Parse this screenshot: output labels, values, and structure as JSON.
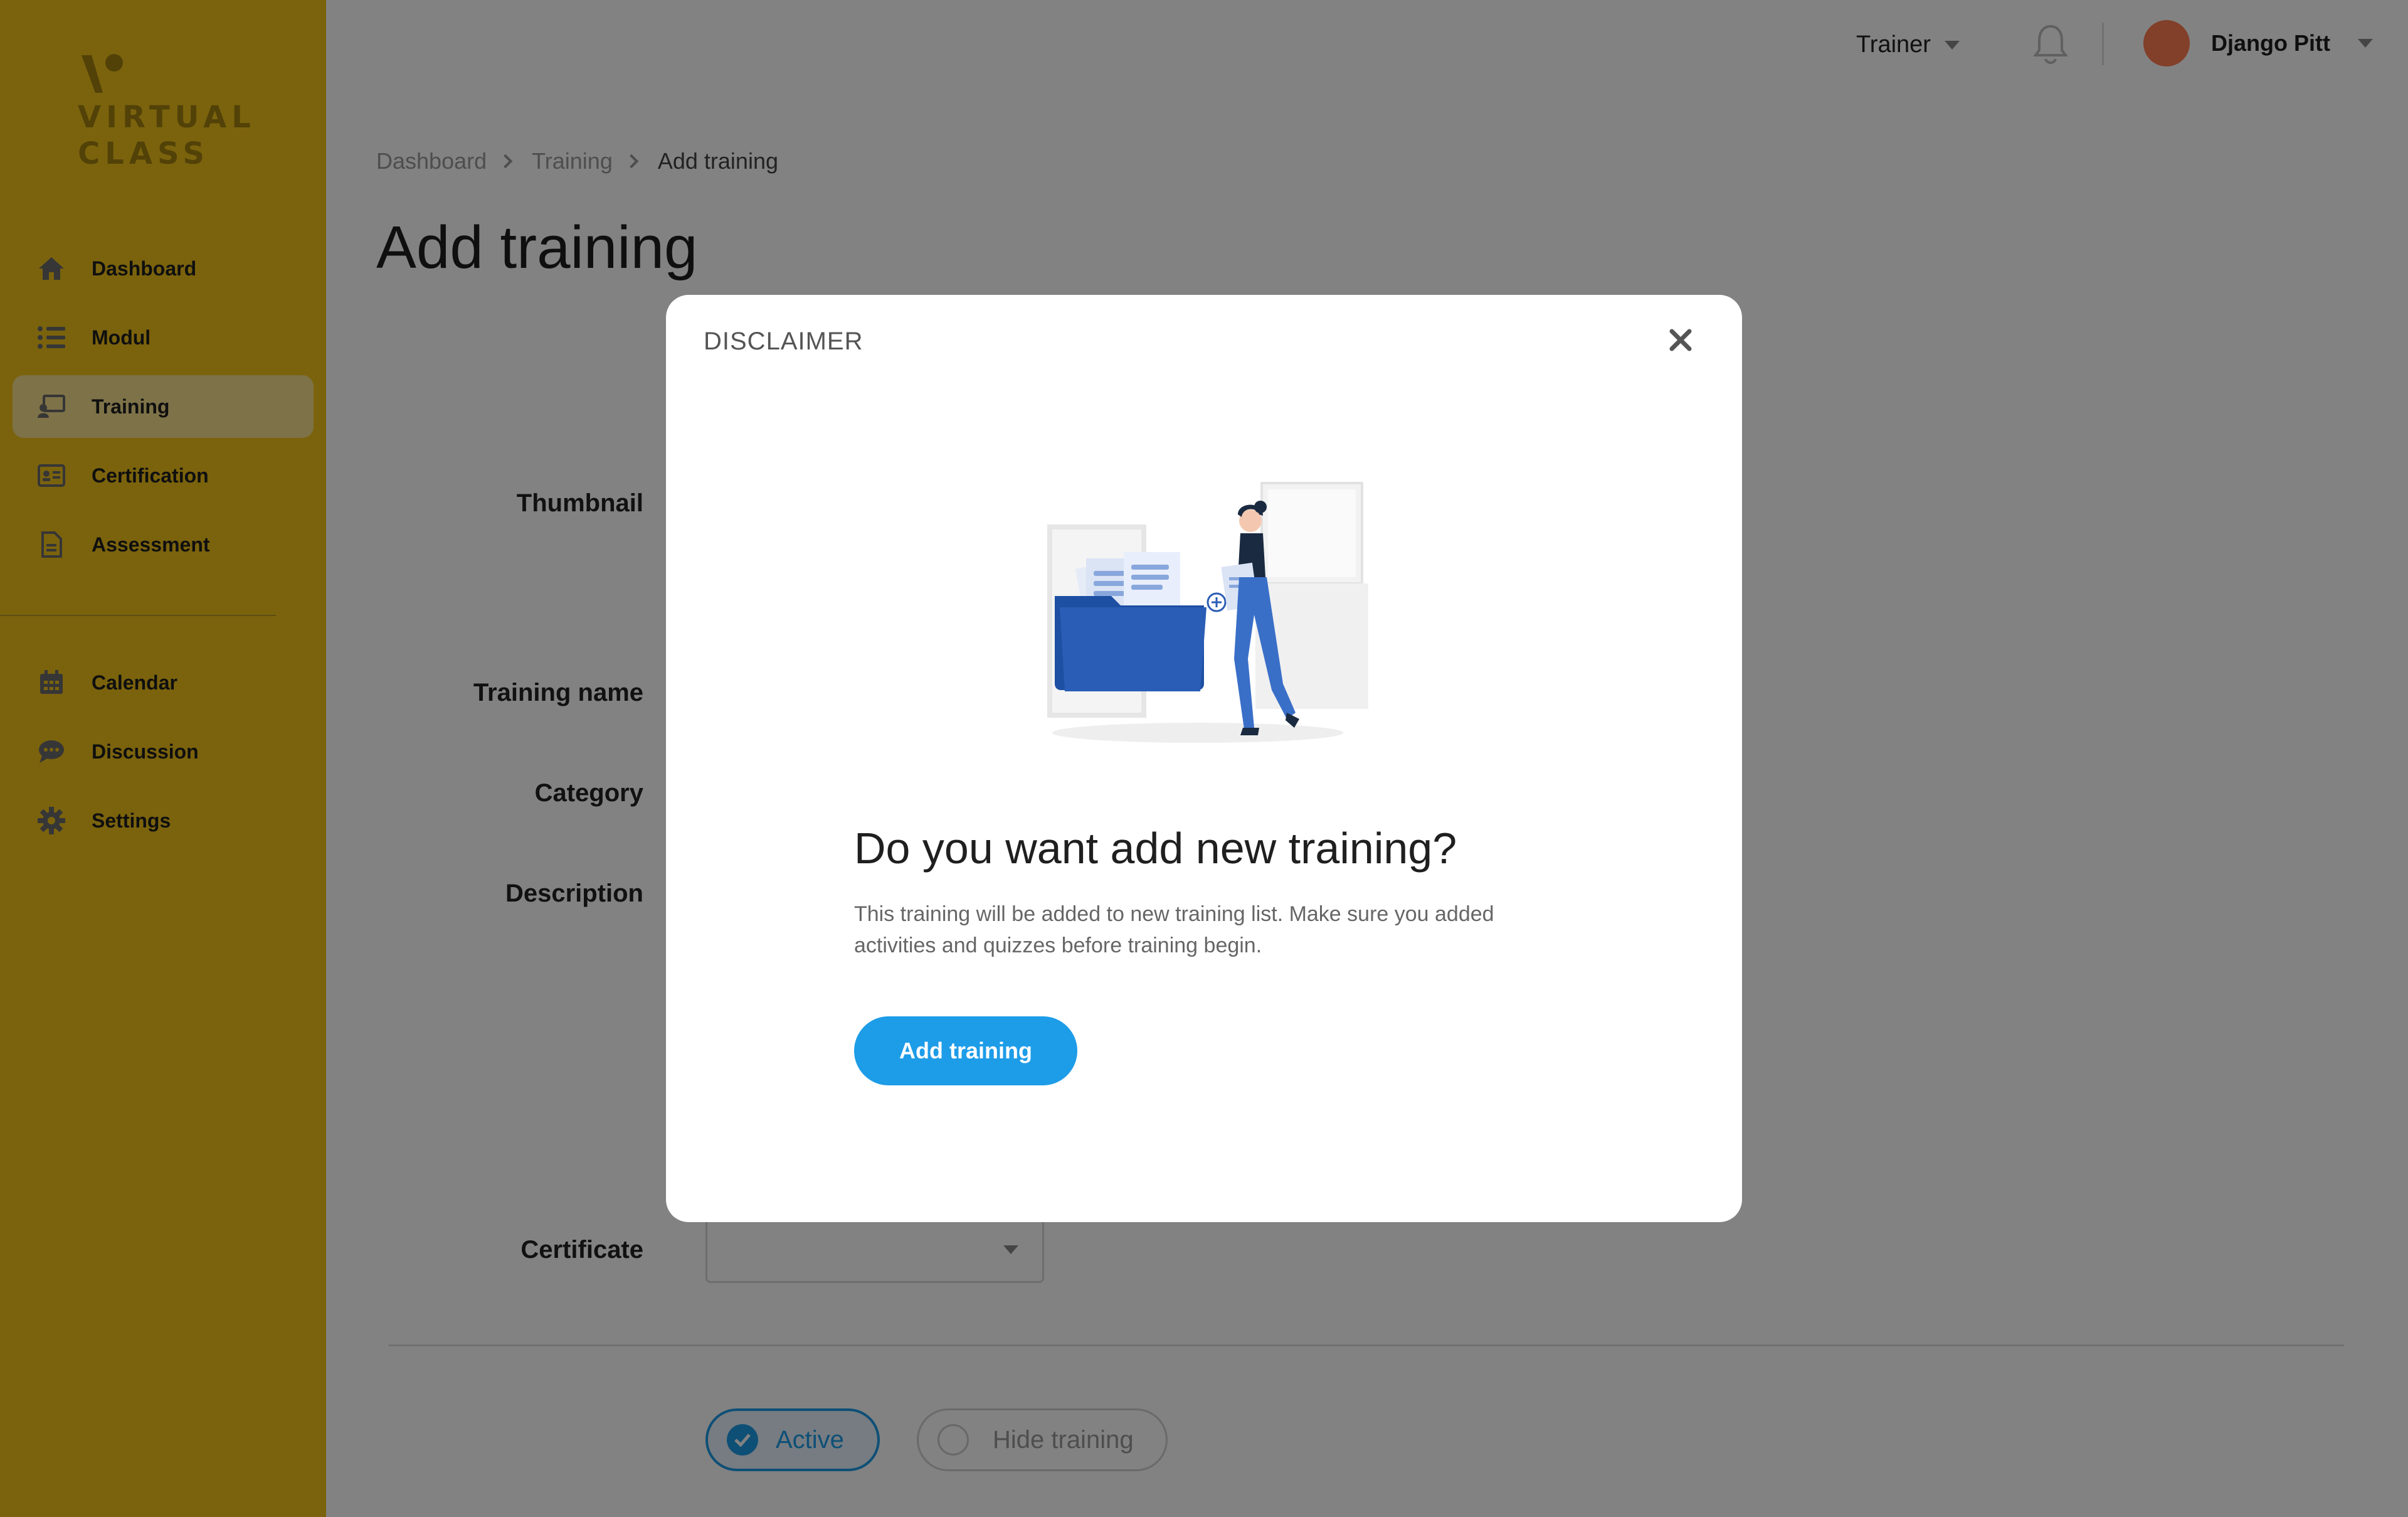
{
  "app": {
    "logo_line1": "VIRTUAL",
    "logo_line2": "CLASS"
  },
  "sidebar": {
    "items": [
      {
        "label": "Dashboard",
        "icon": "home-icon"
      },
      {
        "label": "Modul",
        "icon": "list-icon"
      },
      {
        "label": "Training",
        "icon": "training-icon",
        "active": true
      },
      {
        "label": "Certification",
        "icon": "certificate-icon"
      },
      {
        "label": "Assessment",
        "icon": "document-icon"
      }
    ],
    "secondary_items": [
      {
        "label": "Calendar",
        "icon": "calendar-icon"
      },
      {
        "label": "Discussion",
        "icon": "chat-icon"
      },
      {
        "label": "Settings",
        "icon": "gear-icon"
      }
    ]
  },
  "header": {
    "role": "Trainer",
    "user_name": "Django Pitt",
    "icons": [
      "bell-icon",
      "chevron-down-icon"
    ]
  },
  "breadcrumb": [
    "Dashboard",
    "Training",
    "Add training"
  ],
  "page": {
    "title": "Add training"
  },
  "form": {
    "labels": {
      "thumbnail": "Thumbnail",
      "training_name": "Training name",
      "category": "Category",
      "description": "Description",
      "certificate": "Certificate"
    },
    "certificate_value": "",
    "status_options": {
      "active": "Active",
      "hide": "Hide training"
    },
    "selected_status": "Active"
  },
  "modal": {
    "title": "DISCLAIMER",
    "question": "Do you want add new training?",
    "description": "This training will be added to new training list. Make sure you added activities and quizzes before training begin.",
    "confirm_label": "Add training"
  },
  "colors": {
    "sidebar": "#f1c21b",
    "sidebar_active": "#f8df8e",
    "accent": "#1d9ce8",
    "avatar": "#ff7c52",
    "overlay": "rgba(0,0,0,0.49)"
  }
}
